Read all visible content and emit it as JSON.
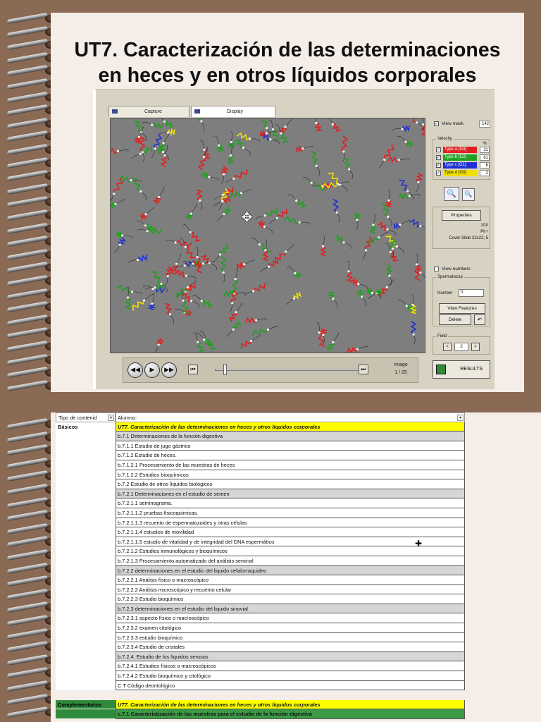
{
  "slide1": {
    "title_line1": "UT7. Caracterización de las determinaciones",
    "title_line2": "en heces y en otros líquidos corporales",
    "screenshot": {
      "tabs": [
        "Capture",
        "Display"
      ],
      "view_mask_label": "View mask",
      "view_mask_value": "142",
      "velocity_label": "Velocity",
      "velocity_col": "%",
      "velocity_types": [
        {
          "label": "Type a [G3]",
          "value": "31",
          "color": "#e02020"
        },
        {
          "label": "Type b [G2]",
          "value": "61",
          "color": "#20a020"
        },
        {
          "label": "Type c [G1]",
          "value": "6",
          "color": "#2030d0"
        },
        {
          "label": "Type d [G0]",
          "value": "2",
          "color": "#f0e000"
        }
      ],
      "properties_label": "Properties",
      "prop_lines": [
        "10X",
        "Ph+",
        "Cover Slide 22x22; 5"
      ],
      "view_numbers_label": "View numbers",
      "spermatozoa_label": "Spermatozoa",
      "number_label": "Number",
      "number_value": "0",
      "view_features_label": "View Features",
      "delete_label": "Delete",
      "field_label": "Field",
      "field_value": "2",
      "image_label": "Image",
      "image_count": "1 / 25",
      "results_label": "RESULTS"
    }
  },
  "slide2": {
    "header": {
      "col1": "Tipo de contenid",
      "col2": "Alumno:"
    },
    "rows": [
      {
        "c1": "Básicos",
        "c2": "UT7. Caracterización de las determinaciones en heces y otros líquidos corporales",
        "style": "yel",
        "c1style": "cat1"
      },
      {
        "c1": "",
        "c2": "b.7.1 Determinaciones de la función digestiva",
        "style": "gry"
      },
      {
        "c1": "",
        "c2": "b.7.1.1 Estudio de jugo gástrico",
        "style": "wht"
      },
      {
        "c1": "",
        "c2": "b.7.1.2 Estudio de heces.",
        "style": "wht"
      },
      {
        "c1": "",
        "c2": "b.7.1.2.1 Procesamiento de las muestras de heces",
        "style": "wht"
      },
      {
        "c1": "",
        "c2": "b.7.1.2.2 Estudios bioquímicos",
        "style": "wht"
      },
      {
        "c1": "",
        "c2": "b.7.2 Estudio de otros líquidos biológicos",
        "style": "wht"
      },
      {
        "c1": "",
        "c2": "b.7.2.1 Determinaciones en el estudio de semen",
        "style": "gry"
      },
      {
        "c1": "",
        "c2": "b.7.2.1.1 seminograma.",
        "style": "wht"
      },
      {
        "c1": "",
        "c2": "b.7.2.1.1.2 pruebas fisicoquímicas.",
        "style": "wht"
      },
      {
        "c1": "",
        "c2": "b.7.2.1.1.3 recuento de espermatozoides y otras células",
        "style": "wht"
      },
      {
        "c1": "",
        "c2": "b.7.2.1.1.4 estudios de movilidad",
        "style": "wht"
      },
      {
        "c1": "",
        "c2": "b.7.2.1.1.5 estudio de vitalidad y de integridad del DNA espermático",
        "style": "wht"
      },
      {
        "c1": "",
        "c2": "b.7.2.1.2 Estudios inmunológicos y bioquímicos",
        "style": "wht"
      },
      {
        "c1": "",
        "c2": "b.7.2.1.3 Procesamiento automatizado del análisis seminal",
        "style": "wht"
      },
      {
        "c1": "",
        "c2": "b.7.2.2 determinaciones en el estudio del liquido cefalorraquideo",
        "style": "gry"
      },
      {
        "c1": "",
        "c2": "b.7.2.2.1 Análisis físico o macroscópico",
        "style": "wht"
      },
      {
        "c1": "",
        "c2": "b.7.2.2.2 Análisis microscópico y recuento celular",
        "style": "wht"
      },
      {
        "c1": "",
        "c2": "b.7.2.2.3 Estudio bioquímico",
        "style": "wht"
      },
      {
        "c1": "",
        "c2": "b.7.2.3 determinaciones en el estudio del liquido sinovial",
        "style": "gry"
      },
      {
        "c1": "",
        "c2": "b.7.2.3.1 aspecto físico o macroscópico",
        "style": "wht"
      },
      {
        "c1": "",
        "c2": "b.7.2.3.2 examen citológico",
        "style": "wht"
      },
      {
        "c1": "",
        "c2": "b.7.2.3.3 estudio bioquímico",
        "style": "wht"
      },
      {
        "c1": "",
        "c2": "b.7.2.3.4 Estudio de cristales",
        "style": "wht"
      },
      {
        "c1": "",
        "c2": "b.7.2.4. Estudio de los líquidos serosos",
        "style": "gry"
      },
      {
        "c1": "",
        "c2": "b.7.2.4.1 Estudios físicos o macroscópicos",
        "style": "wht"
      },
      {
        "c1": "",
        "c2": "b.7.2.4.2 Estudio bioquímico y citológico",
        "style": "wht"
      },
      {
        "c1": "",
        "c2": "C.T Código deontológico",
        "style": "wht"
      },
      {
        "c1": "",
        "c2": "",
        "style": "gap"
      },
      {
        "c1": "Complementarios",
        "c2": "UT7. Caracterización de las determinaciones en heces y otros líquidos corporales",
        "style": "yel",
        "c1style": "cat2"
      },
      {
        "c1": "",
        "c2": "c.7.1 Caracteristización de las muestras para el estudio de la función digestiva",
        "style": "grn",
        "c1style": "cat2"
      }
    ]
  }
}
